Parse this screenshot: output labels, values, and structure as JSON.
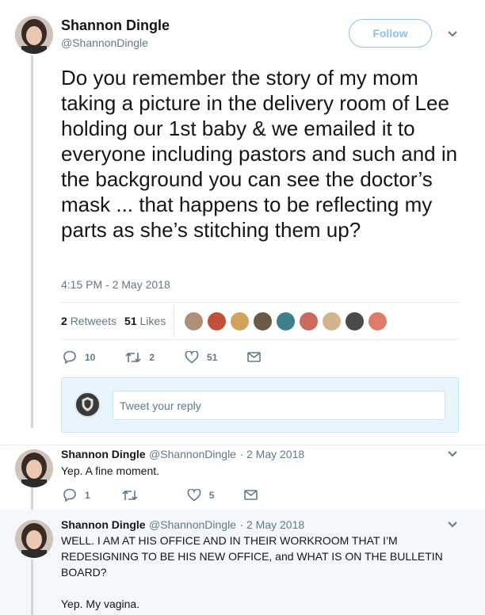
{
  "main_tweet": {
    "author_name": "Shannon Dingle",
    "author_handle": "@ShannonDingle",
    "follow_label": "Follow",
    "text": "Do you remember the story of my mom taking a picture in the delivery room of Lee holding our 1st baby & we emailed it to everyone including pastors and such and in the background you can see the doctor’s mask ... that happens to be reflecting my parts as she’s stitching them up?",
    "timestamp": "4:15 PM - 2 May 2018",
    "retweets_count": "2",
    "retweets_label": "Retweets",
    "likes_count": "51",
    "likes_label": "Likes",
    "actions": {
      "replies": "10",
      "retweets": "2",
      "likes": "51"
    }
  },
  "likers": [
    "#b08f7a",
    "#c0503a",
    "#d1a35a",
    "#6b5a48",
    "#3f7f8c",
    "#c86b5e",
    "#d2b48c",
    "#4a4a4a",
    "#e07a6a"
  ],
  "reply_box": {
    "placeholder": "Tweet your reply"
  },
  "replies": [
    {
      "author_name": "Shannon Dingle",
      "author_handle": "@ShannonDingle",
      "date": "· 2 May 2018",
      "text": "Yep. A fine moment.",
      "actions": {
        "replies": "1",
        "retweets": "",
        "likes": "5"
      }
    },
    {
      "author_name": "Shannon Dingle",
      "author_handle": "@ShannonDingle",
      "date": "· 2 May 2018",
      "text_line1": "WELL. I AM AT HIS OFFICE AND IN THEIR WORKROOM THAT I’M REDESIGNING TO BE HIS NEW OFFICE, and WHAT IS ON THE BULLETIN BOARD?",
      "text_line2": "Yep. My vagina."
    }
  ],
  "colors": {
    "accent": "#1da1f2",
    "muted": "#657786",
    "border": "#e6ecf0"
  }
}
